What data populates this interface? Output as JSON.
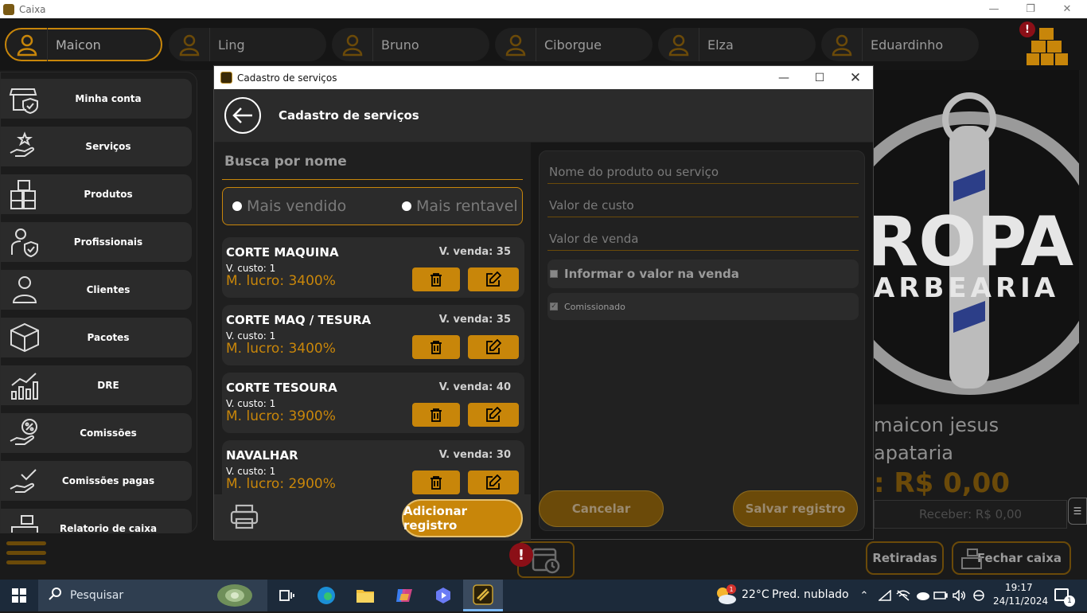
{
  "app": {
    "title": "Caixa"
  },
  "users": [
    {
      "name": "Maicon",
      "active": true
    },
    {
      "name": "Ling",
      "active": false
    },
    {
      "name": "Bruno",
      "active": false
    },
    {
      "name": "Ciborgue",
      "active": false
    },
    {
      "name": "Elza",
      "active": false
    },
    {
      "name": "Eduardinho",
      "active": false
    }
  ],
  "alert_badge": "!",
  "sidebar": {
    "items": [
      {
        "label": "Minha conta",
        "icon": "shop-shield-icon"
      },
      {
        "label": "Serviços",
        "icon": "hand-star-icon"
      },
      {
        "label": "Produtos",
        "icon": "boxes-icon"
      },
      {
        "label": "Profissionais",
        "icon": "person-shield-icon"
      },
      {
        "label": "Clientes",
        "icon": "person-icon"
      },
      {
        "label": "Pacotes",
        "icon": "package-icon"
      },
      {
        "label": "DRE",
        "icon": "bar-chart-icon"
      },
      {
        "label": "Comissões",
        "icon": "hand-percent-icon"
      },
      {
        "label": "Comissões pagas",
        "icon": "hand-check-icon"
      },
      {
        "label": "Relatorio de caixa",
        "icon": "register-icon"
      }
    ]
  },
  "background": {
    "client_name": "maicon jesus",
    "client_line2": "apataria",
    "total": ": R$ 0,00",
    "receber": "Receber: R$ 0,00",
    "retiradas": "Retiradas",
    "fechar_caixa": "Fechar caixa"
  },
  "dialog": {
    "window_title": "Cadastro de serviços",
    "header_title": "Cadastro de serviços",
    "search_placeholder": "Busca por nome",
    "filter_most_sold": "Mais vendidos",
    "filter_most_profitable": "Mais rentavel",
    "services": [
      {
        "name": "CORTE MAQUINA",
        "venda": "V. venda: 35",
        "custo": "V. custo: 1",
        "lucro": "M. lucro: 3400%"
      },
      {
        "name": "CORTE MAQ / TESURA",
        "venda": "V. venda: 35",
        "custo": "V. custo: 1",
        "lucro": "M. lucro: 3400%"
      },
      {
        "name": "CORTE TESOURA",
        "venda": "V. venda: 40",
        "custo": "V. custo: 1",
        "lucro": "M. lucro: 3900%"
      },
      {
        "name": "NAVALHAR",
        "venda": "V. venda: 30",
        "custo": "V. custo: 1",
        "lucro": "M. lucro: 2900%"
      }
    ],
    "add_button": "Adicionar registro",
    "form": {
      "name_placeholder": "Nome do produto ou serviço",
      "cost_placeholder": "Valor de custo",
      "price_placeholder": "Valor de venda",
      "inform_value_label": "Informar o valor na venda",
      "commissioned_label": "Comissionado",
      "cancel": "Cancelar",
      "save": "Salvar registro"
    }
  },
  "taskbar": {
    "search": "Pesquisar",
    "weather_temp": "22°C",
    "weather_desc": "Pred. nublado",
    "time": "19:17",
    "date": "24/11/2024",
    "notifications": "1",
    "weather_badge": "1"
  },
  "colors": {
    "accent": "#c8860a",
    "accent_dark": "#6b4a09",
    "panel": "#2b2b2b"
  }
}
